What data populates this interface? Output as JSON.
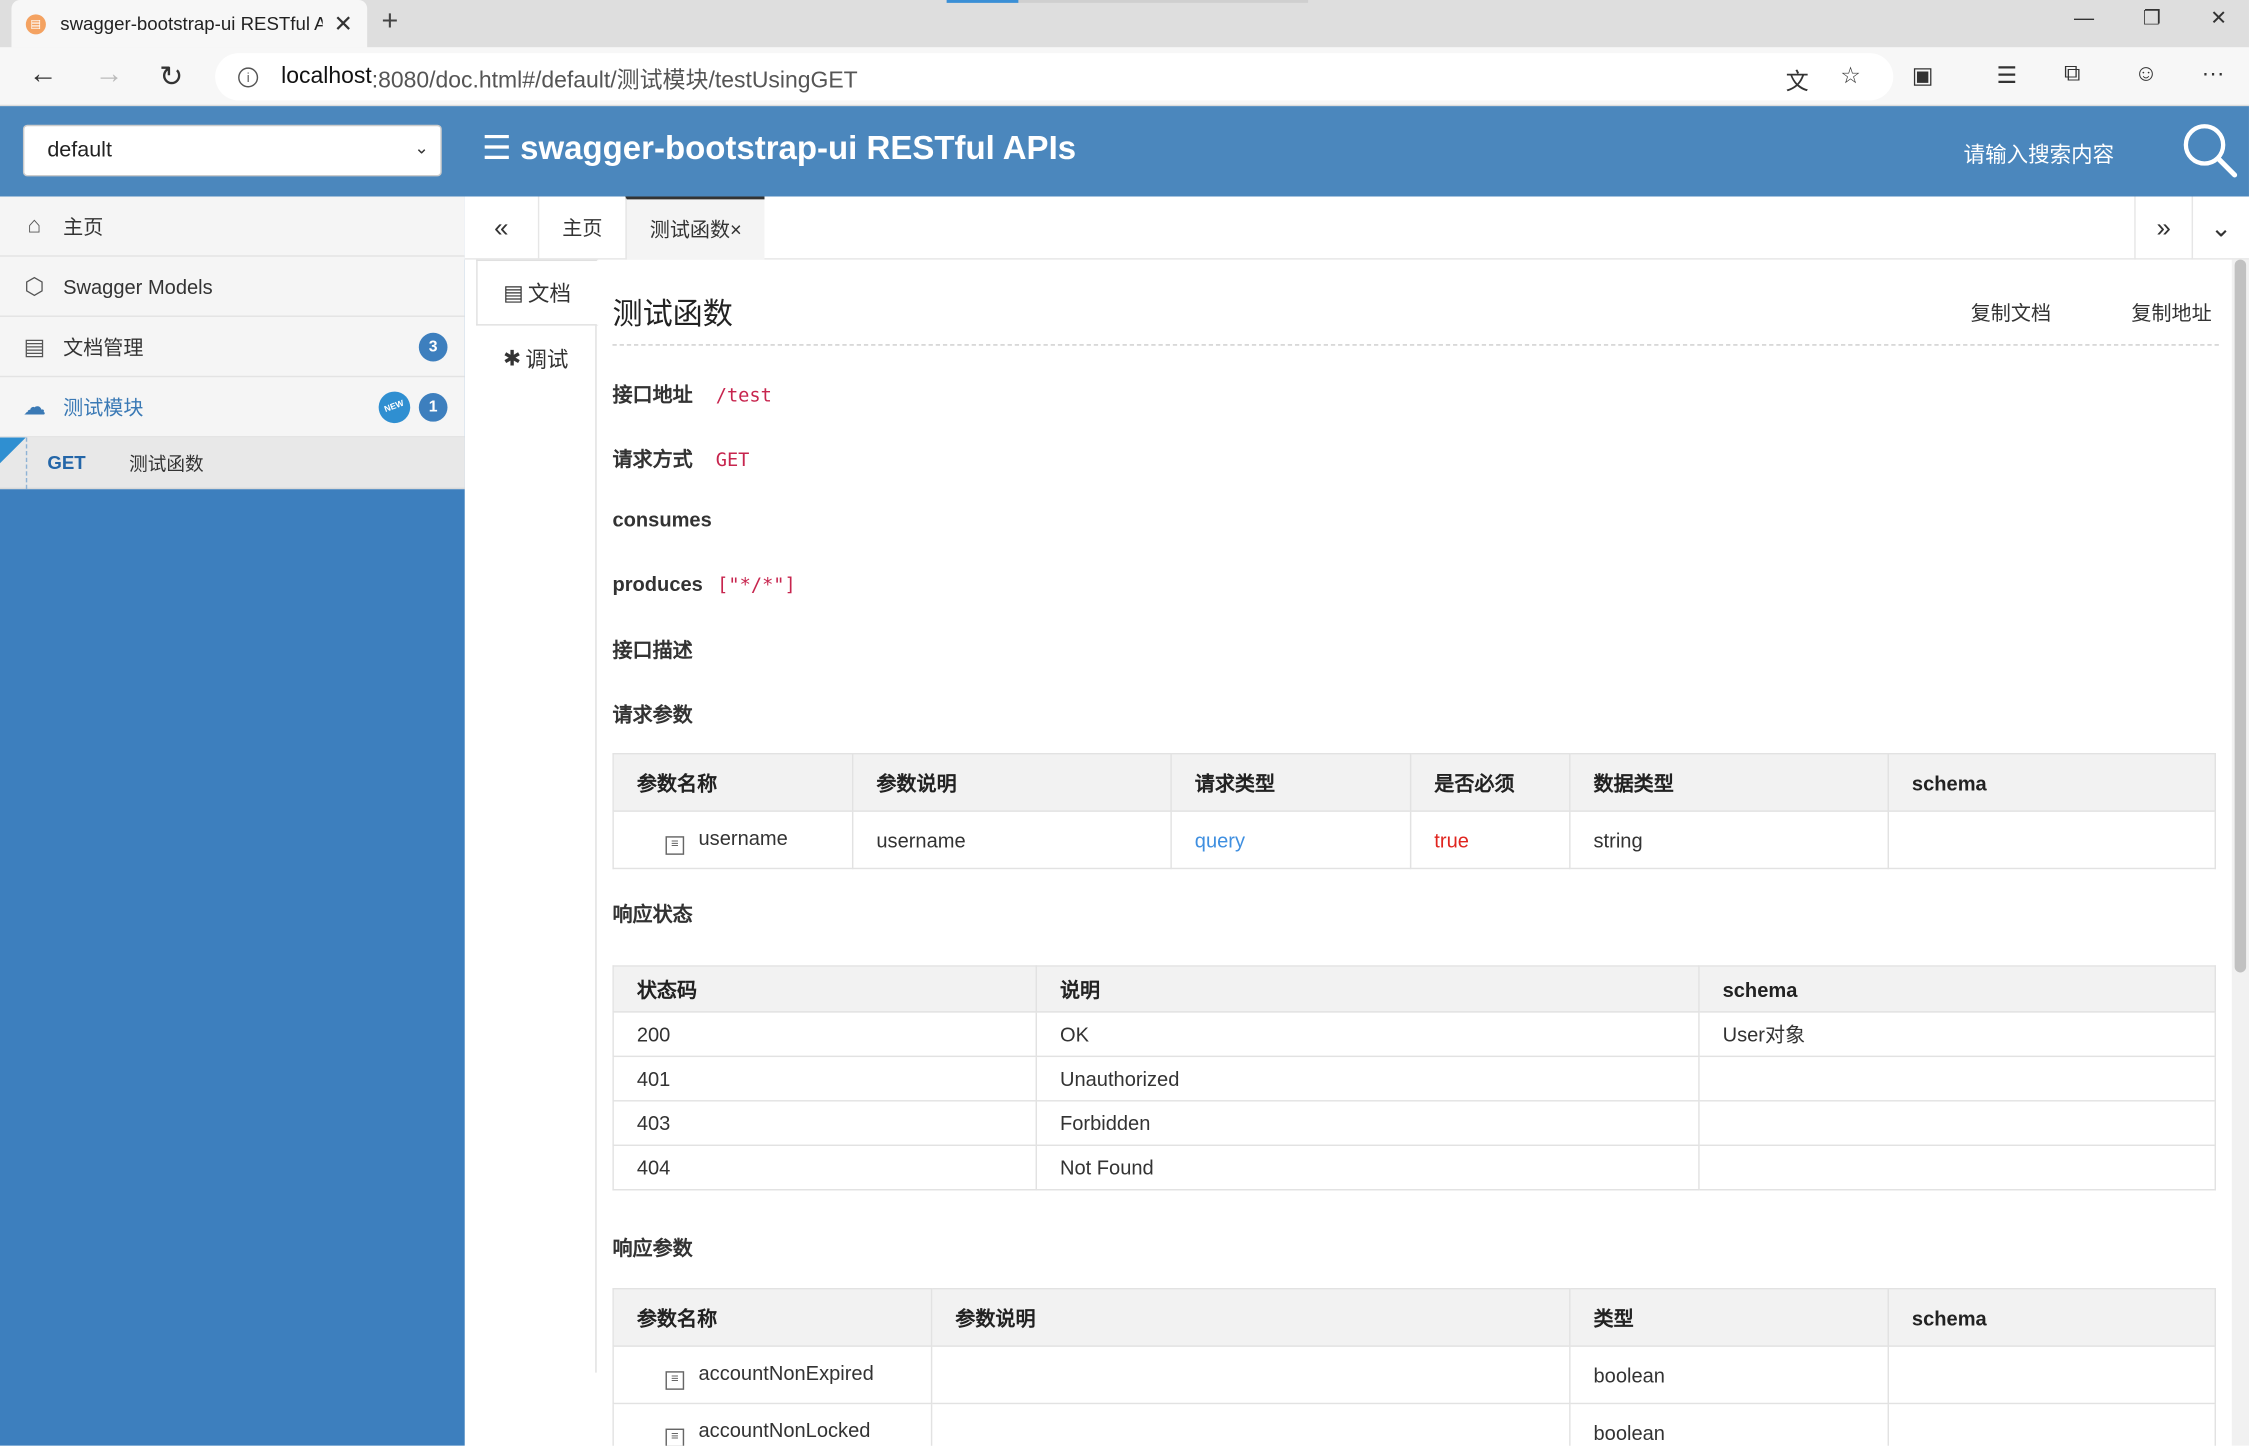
{
  "browser": {
    "tab_title": "swagger-bootstrap-ui RESTful AP",
    "url_host": "localhost",
    "url_path": ":8080/doc.html#/default/测试模块/testUsingGET",
    "new_tab": "+",
    "close": "✕",
    "minimize": "—",
    "restore": "❐",
    "window_close": "✕"
  },
  "header": {
    "group_value": "default",
    "title": "swagger-bootstrap-ui RESTful APIs",
    "search_placeholder": "请输入搜索内容",
    "brand_color": "#4b87bd"
  },
  "sidebar": {
    "items": [
      {
        "label": "主页",
        "icon": "home-icon"
      },
      {
        "label": "Swagger Models",
        "icon": "models-icon"
      },
      {
        "label": "文档管理",
        "icon": "doc-settings-icon",
        "badge": "3"
      },
      {
        "label": "测试模块",
        "icon": "cloud-api-icon",
        "badge": "1",
        "new_badge": "NEW"
      }
    ],
    "sub_items": [
      {
        "method": "GET",
        "label": "测试函数"
      }
    ]
  },
  "content_tabs": {
    "items": [
      "主页",
      "测试函数×"
    ]
  },
  "side_tabs": {
    "doc": "文档",
    "debug": "调试"
  },
  "doc": {
    "title": "测试函数",
    "copy_doc": "复制文档",
    "copy_url": "复制地址",
    "address_label": "接口地址",
    "address_value": "/test",
    "method_label": "请求方式",
    "method_value": "GET",
    "consumes_label": "consumes",
    "produces_label": "produces",
    "produces_value": "[\"*/*\"]",
    "desc_label": "接口描述",
    "req_params_label": "请求参数",
    "resp_status_label": "响应状态",
    "resp_params_label": "响应参数",
    "req_table": {
      "headers": [
        "参数名称",
        "参数说明",
        "请求类型",
        "是否必须",
        "数据类型",
        "schema"
      ],
      "rows": [
        {
          "name": "username",
          "desc": "username",
          "in": "query",
          "required": "true",
          "type": "string",
          "schema": ""
        }
      ]
    },
    "status_table": {
      "headers": [
        "状态码",
        "说明",
        "schema"
      ],
      "rows": [
        {
          "code": "200",
          "desc": "OK",
          "schema": "User对象"
        },
        {
          "code": "401",
          "desc": "Unauthorized",
          "schema": ""
        },
        {
          "code": "403",
          "desc": "Forbidden",
          "schema": ""
        },
        {
          "code": "404",
          "desc": "Not Found",
          "schema": ""
        }
      ]
    },
    "resp_table": {
      "headers": [
        "参数名称",
        "参数说明",
        "类型",
        "schema"
      ],
      "rows": [
        {
          "name": "accountNonExpired",
          "desc": "",
          "type": "boolean",
          "schema": ""
        },
        {
          "name": "accountNonLocked",
          "desc": "",
          "type": "boolean",
          "schema": ""
        }
      ]
    }
  }
}
